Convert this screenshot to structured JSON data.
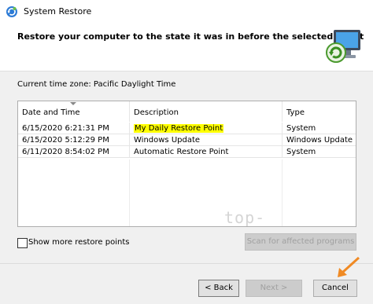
{
  "window": {
    "title": "System Restore"
  },
  "header": {
    "heading": "Restore your computer to the state it was in before the selected event"
  },
  "timezone_label": "Current time zone: Pacific Daylight Time",
  "table": {
    "columns": [
      "Date and Time",
      "Description",
      "Type"
    ],
    "rows": [
      {
        "date": "6/15/2020 6:21:31 PM",
        "description": "My Daily Restore Point",
        "type": "System",
        "highlighted": true
      },
      {
        "date": "6/15/2020 5:12:29 PM",
        "description": "Windows Update",
        "type": "Windows Update"
      },
      {
        "date": "6/11/2020 8:54:02 PM",
        "description": "Automatic Restore Point",
        "type": "System"
      }
    ]
  },
  "watermark": "top-password.com",
  "options": {
    "show_more": "Show more restore points",
    "scan": "Scan for affected programs"
  },
  "buttons": {
    "back": "< Back",
    "next": "Next >",
    "cancel": "Cancel"
  },
  "colors": {
    "highlight": "#ffff00",
    "arrow": "#f08a24"
  }
}
